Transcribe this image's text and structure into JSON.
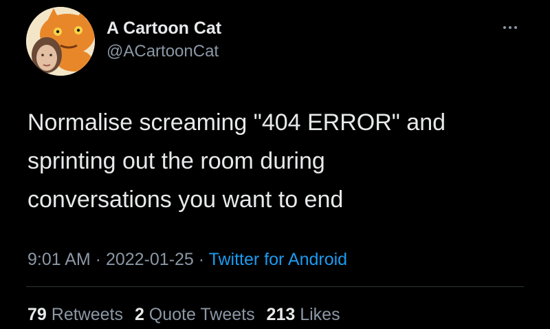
{
  "tweet": {
    "author": {
      "display_name": "A Cartoon Cat",
      "handle": "@ACartoonCat",
      "avatar_icon": "cartoon-cat-avatar-icon"
    },
    "more_icon": "more-dots-icon",
    "text_lines": [
      "Normalise screaming \"404 ERROR\" and",
      "sprinting out the room during",
      "conversations you want to end"
    ],
    "time": "9:01 AM",
    "date": "2022-01-25",
    "separator": " · ",
    "source": "Twitter for Android",
    "stats": {
      "retweets_count": "79",
      "retweets_label": "Retweets",
      "quotes_count": "2",
      "quotes_label": "Quote Tweets",
      "likes_count": "213",
      "likes_label": "Likes"
    }
  },
  "colors": {
    "background": "#000000",
    "text_primary": "#e7e9ea",
    "text_secondary": "#8b98a5",
    "link": "#1d9bf0",
    "divider": "#2f3336"
  }
}
